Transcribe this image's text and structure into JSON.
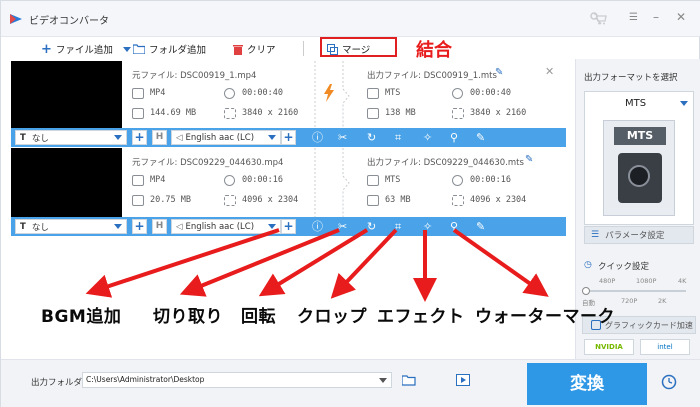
{
  "app": {
    "title": "ビデオコンバータ"
  },
  "toolbar": {
    "add_file": "ファイル追加",
    "add_folder": "フォルダ追加",
    "clear": "クリア",
    "merge": "マージ"
  },
  "annotation": {
    "merge_label": "結合",
    "labels": [
      "BGM追加",
      "切り取り",
      "回転",
      "クロップ",
      "エフェクト",
      "ウォーターマーク"
    ]
  },
  "files": [
    {
      "source_name": "元ファイル: DSC00919_1.mp4",
      "source_format": "MP4",
      "source_duration": "00:00:40",
      "source_size": "144.69 MB",
      "source_resolution": "3840 x 2160",
      "output_name": "出力ファイル: DSC00919_1.mts",
      "output_format": "MTS",
      "output_duration": "00:00:40",
      "output_size": "138 MB",
      "output_resolution": "3840 x 2160",
      "subtitle": "なし",
      "audio": "English aac (LC)"
    },
    {
      "source_name": "元ファイル: DSC09229_044630.mp4",
      "source_format": "MP4",
      "source_duration": "00:00:16",
      "source_size": "20.75 MB",
      "source_resolution": "4096 x 2304",
      "output_name": "出力ファイル: DSC09229_044630.mts",
      "output_format": "MTS",
      "output_duration": "00:00:16",
      "output_size": "63 MB",
      "output_resolution": "4096 x 2304",
      "subtitle": "なし",
      "audio": "English aac (LC)"
    }
  ],
  "sidebar": {
    "select_format": "出力フォーマットを選択",
    "format": "MTS",
    "format_icon_text": "MTS",
    "param_settings": "パラメータ設定",
    "quick_settings": "クイック設定",
    "quality_ticks": [
      "480P",
      "1080P",
      "4K"
    ],
    "quality_ticks_bottom": [
      "自動",
      "720P",
      "2K"
    ],
    "gpu_accel": "グラフィックカード加速",
    "nvidia": "NVIDIA",
    "intel": "intel"
  },
  "bottom": {
    "output_folder_label": "出力フォルダ:",
    "output_path": "C:\\Users\\Administrator\\Desktop",
    "convert": "変換"
  },
  "colors": {
    "accent": "#4aa3e8",
    "convert": "#2f98e6",
    "annotation": "#e81c1c"
  }
}
